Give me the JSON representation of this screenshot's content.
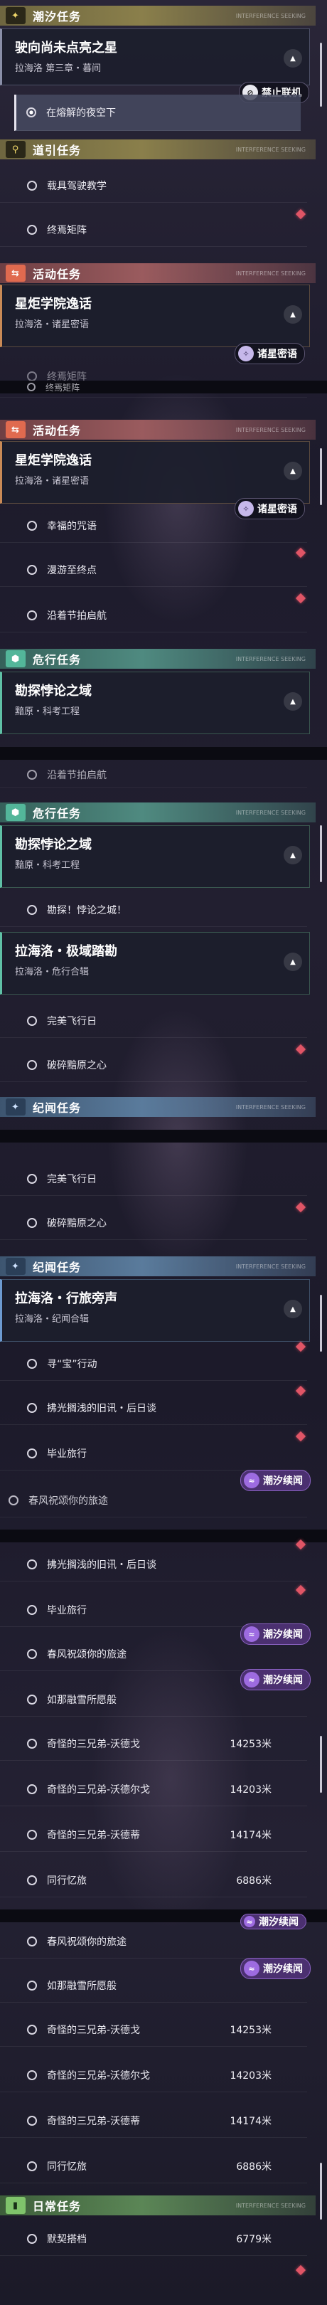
{
  "categories": {
    "tidal": {
      "label": "潮汐任务",
      "icon": "star-icon"
    },
    "guide": {
      "label": "道引任务",
      "icon": "location-pin-icon"
    },
    "activity": {
      "label": "活动任务",
      "icon": "exchange-icon"
    },
    "danger": {
      "label": "危行任务",
      "icon": "hexagon-icon"
    },
    "chronicle": {
      "label": "纪闻任务",
      "icon": "star-icon"
    },
    "daily": {
      "label": "日常任务",
      "icon": "book-icon"
    }
  },
  "decoration_text": "INTERFERENCE SEEKING",
  "quests": {
    "tidal_main": {
      "title": "驶向尚未点亮之星",
      "subtitle": "拉海洛 第三章・暮间"
    },
    "activity_main": {
      "title": "星炬学院逸话",
      "subtitle": "拉海洛・诸星密语"
    },
    "danger_main": {
      "title": "勘探悖论之域",
      "subtitle": "黯原・科考工程"
    },
    "danger_second": {
      "title": "拉海洛・极域踏勘",
      "subtitle": "拉海洛・危行合辑"
    },
    "chronicle_main": {
      "title": "拉海洛・行旅旁声",
      "subtitle": "拉海洛・纪闻合辑"
    }
  },
  "items": {
    "night": "在熔解的夜空下",
    "drive": "载具驾驶教学",
    "array": "终焉矩阵",
    "spell": "幸福的咒语",
    "roam": "漫游至终点",
    "sail": "沿着节拍启航",
    "explore": "勘探！悖论之城！",
    "flight": "完美飞行日",
    "shatter": "破碎黯原之心",
    "treasure": "寻“宝”行动",
    "notes": "拂光搁浅的旧讯・后日谈",
    "grad": "毕业旅行",
    "spring": "春风祝颂你的旅途",
    "snow": "如那融雪所愿般",
    "brothers_ge": "奇怪的三兄弟-沃德戈",
    "brothers_er": "奇怪的三兄弟-沃德尔戈",
    "brothers_di": "奇怪的三兄弟-沃德蒂",
    "companion": "同行忆旅",
    "tipping": "默契搭档"
  },
  "distances": {
    "ge": "14253米",
    "er": "14203米",
    "di": "14174米",
    "companion": "6886米",
    "tipping": "6779米"
  },
  "badges": {
    "online": {
      "label": "禁止联机",
      "icon": "no-online-icon"
    },
    "secret": {
      "label": "诸星密语",
      "icon": "crossed-stars-icon"
    },
    "tidal": {
      "label": "潮汐续闻",
      "icon": "tidal-icon"
    }
  },
  "colors": {
    "tidal": "#8a7f4b",
    "guide": "#8a7f4b",
    "activity": "#9a5b5e",
    "danger": "#4f8a80",
    "chronicle": "#5a7b9c",
    "daily": "#5b8656",
    "marker": "#e05566",
    "tidal_badge": "#9d6be0"
  }
}
